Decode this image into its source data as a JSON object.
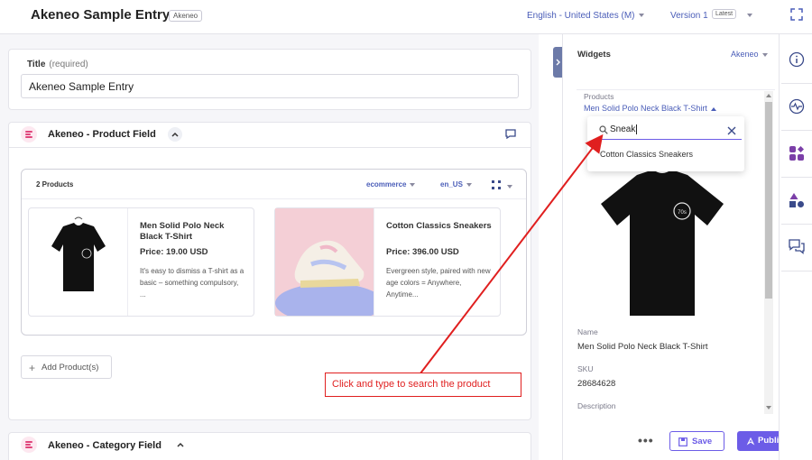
{
  "header": {
    "title": "Akeneo Sample Entry",
    "tag": "Akeneo",
    "locale": "English - United States (M)",
    "version": "Version 1",
    "version_badge": "Latest"
  },
  "form": {
    "title_label": "Title",
    "title_required": "(required)",
    "title_value": "Akeneo Sample Entry"
  },
  "product_field": {
    "title": "Akeneo - Product Field",
    "count": "2 Products",
    "channel": "ecommerce",
    "locale": "en_US",
    "products": [
      {
        "name": "Men Solid Polo Neck Black T-Shirt",
        "price": "Price: 19.00 USD",
        "description": "It's easy to dismiss a T-shirt as a basic – something compulsory, ..."
      },
      {
        "name": "Cotton Classics Sneakers",
        "price": "Price: 396.00 USD",
        "description": "Evergreen style, paired with new age colors = Anywhere, Anytime..."
      }
    ],
    "add_label": "Add Product(s)"
  },
  "category_field": {
    "title": "Akeneo - Category Field"
  },
  "callout": "Click and type to search the product",
  "sidebar": {
    "widgets_label": "Widgets",
    "widget_select": "Akeneo",
    "products_label": "Products",
    "selected_product": "Men Solid Polo Neck Black T-Shirt",
    "search_value": "Sneak",
    "search_option": "Cotton Classics Sneakers",
    "name_label": "Name",
    "name_value": "Men Solid Polo Neck Black T-Shirt",
    "sku_label": "SKU",
    "sku_value": "28684628",
    "description_label": "Description"
  },
  "footer": {
    "more": "•••",
    "save": "Save",
    "publish": "Publish"
  },
  "rail": [
    "info-icon",
    "activity-icon",
    "extensions-icon",
    "shapes-icon",
    "chat-icon"
  ],
  "colors": {
    "accent": "#6c5ce7",
    "link": "#4a5db8",
    "callout_red": "#e01f1f",
    "field_pink": "#e0457b"
  }
}
